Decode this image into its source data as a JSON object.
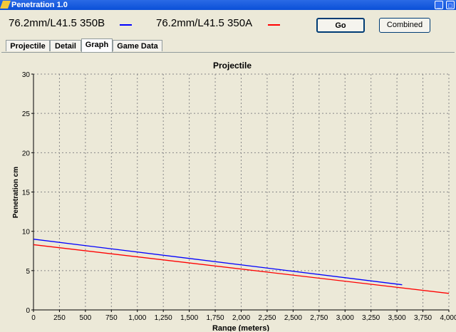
{
  "window": {
    "title": "Penetration 1.0",
    "min_label": "_",
    "close_label": "□"
  },
  "legend": [
    {
      "label": "76.2mm/L41.5 350B",
      "color": "#0000ff"
    },
    {
      "label": "76.2mm/L41.5 350A",
      "color": "#ff0000"
    }
  ],
  "buttons": {
    "go": "Go",
    "combined": "Combined"
  },
  "tabs": [
    "Projectile",
    "Detail",
    "Graph",
    "Game Data"
  ],
  "active_tab": "Graph",
  "chart_data": {
    "type": "line",
    "title": "Projectile",
    "xlabel": "Range (meters)",
    "ylabel": "Penetration cm",
    "xlim": [
      0,
      4000
    ],
    "ylim": [
      0,
      30
    ],
    "xticks": [
      "0",
      "250",
      "500",
      "750",
      "1,000",
      "1,250",
      "1,500",
      "1,750",
      "2,000",
      "2,250",
      "2,500",
      "2,750",
      "3,000",
      "3,250",
      "3,500",
      "3,750",
      "4,000"
    ],
    "yticks": [
      "0",
      "5",
      "10",
      "15",
      "20",
      "25",
      "30"
    ],
    "grid": true,
    "series": [
      {
        "name": "76.2mm/L41.5 350B",
        "color": "#0000ff",
        "points": [
          [
            0,
            9.0
          ],
          [
            3550,
            3.2
          ]
        ]
      },
      {
        "name": "76.2mm/L41.5 350A",
        "color": "#ff0000",
        "points": [
          [
            0,
            8.3
          ],
          [
            4000,
            2.1
          ]
        ]
      }
    ]
  }
}
